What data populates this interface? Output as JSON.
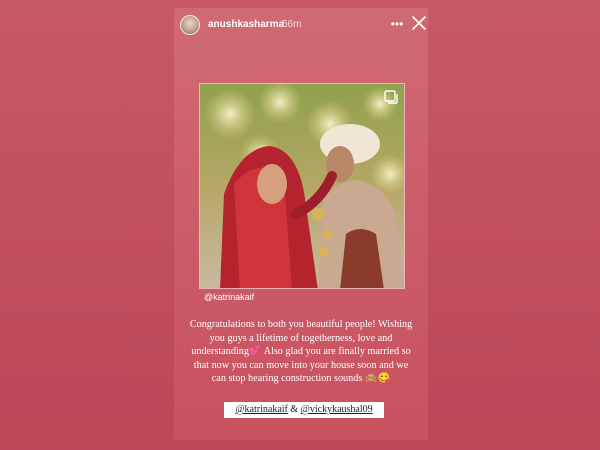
{
  "story": {
    "username": "anushkasharma",
    "time": "56m",
    "more_icon": "more-horizontal-icon",
    "close_icon": "close-icon",
    "photo_mention": "@katrinakaif",
    "caption": "Congratulations to both you beautiful people! Wishing you guys a lifetime of togetherness, love and understanding💕 Also glad you are finally married so that now you can move into your house soon and we can stop hearing construction sounds 🙈😋",
    "tags": {
      "first": "@katrinakaif",
      "joiner": " & ",
      "second": "@vickykaushal09"
    }
  },
  "colors": {
    "background": "#c65a66",
    "story_card": "#cc5d69"
  }
}
